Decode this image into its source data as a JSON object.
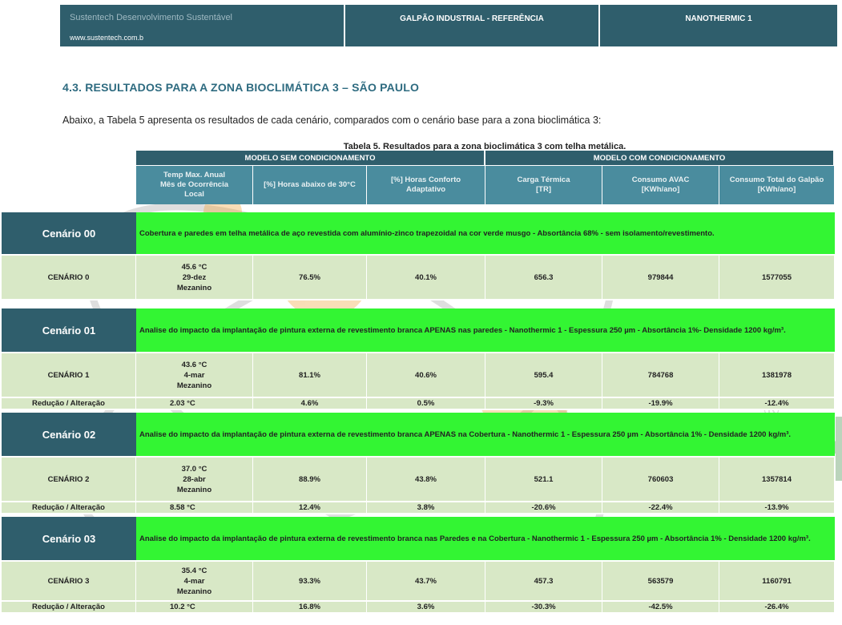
{
  "header": {
    "company": "Sustentech Desenvolvimento Sustentável",
    "site": "www.sustentech.com.b",
    "reference": "GALPÃO INDUSTRIAL - REFERÊNCIA",
    "product": "NANOTHERMIC 1"
  },
  "section_title": "4.3. RESULTADOS PARA A ZONA BIOCLIMÁTICA 3 – SÃO PAULO",
  "intro": "Abaixo, a Tabela 5 apresenta os resultados de cada cenário, comparados com o cenário base para a zona bioclimática 3:",
  "caption": "Tabela 5. Resultados para a zona bioclimática 3 com telha metálica.",
  "table": {
    "group_left": "MODELO SEM CONDICIONAMENTO",
    "group_right": "MODELO COM CONDICIONAMENTO",
    "columns": [
      "Temp Max. Anual\nMês de Ocorrência\nLocal",
      "[%] Horas abaixo de 30°C",
      "[%] Horas Conforto\nAdaptativo",
      "Carga Térmica\n[TR]",
      "Consumo AVAC\n[KWh/ano]",
      "Consumo Total do Galpão\n[KWh/ano]"
    ],
    "reduction_label": "Redução / Alteração",
    "scenarios": [
      {
        "title": "Cenário 00",
        "description": "Cobertura e paredes em telha metálica de aço revestida com alumínio-zinco trapezoidal na cor verde musgo - Absortância 68% - sem isolamento/revestimento.",
        "row_label": "CENÁRIO 0",
        "temp": "45.6   °C",
        "month": "29-dez",
        "local": "Mezanino",
        "hours_below_30": "76.5%",
        "comfort": "40.1%",
        "thermal_load": "656.3",
        "hvac": "979844",
        "total": "1577055",
        "reduction": null
      },
      {
        "title": "Cenário 01",
        "description": "Analise do impacto da implantação de pintura externa de revestimento branca APENAS nas paredes - Nanothermic 1 - Espessura 250 µm - Absortância 1%- Densidade 1200 kg/m³.",
        "row_label": "CENÁRIO 1",
        "temp": "43.6   °C",
        "month": "4-mar",
        "local": "Mezanino",
        "hours_below_30": "81.1%",
        "comfort": "40.6%",
        "thermal_load": "595.4",
        "hvac": "784768",
        "total": "1381978",
        "reduction": {
          "temp": "2.03   °C",
          "hours_below_30": "4.6%",
          "comfort": "0.5%",
          "thermal_load": "-9.3%",
          "hvac": "-19.9%",
          "total": "-12.4%"
        }
      },
      {
        "title": "Cenário 02",
        "description": "Analise do impacto da implantação de pintura externa de revestimento branca APENAS na Cobertura - Nanothermic 1 - Espessura 250 µm - Absortância 1% - Densidade 1200 kg/m³.",
        "row_label": "CENÁRIO 2",
        "temp": "37.0   °C",
        "month": "28-abr",
        "local": "Mezanino",
        "hours_below_30": "88.9%",
        "comfort": "43.8%",
        "thermal_load": "521.1",
        "hvac": "760603",
        "total": "1357814",
        "reduction": {
          "temp": "8.58   °C",
          "hours_below_30": "12.4%",
          "comfort": "3.8%",
          "thermal_load": "-20.6%",
          "hvac": "-22.4%",
          "total": "-13.9%"
        }
      },
      {
        "title": "Cenário 03",
        "description": "Analise do impacto da implantação de pintura externa de revestimento branca nas Paredes e na Cobertura - Nanothermic 1 - Espessura 250 µm - Absortância 1% - Densidade 1200 kg/m³.",
        "row_label": "CENÁRIO 3",
        "temp": "35.4   °C",
        "month": "4-mar",
        "local": "Mezanino",
        "hours_below_30": "93.3%",
        "comfort": "43.7%",
        "thermal_load": "457.3",
        "hvac": "563579",
        "total": "1160791",
        "reduction": {
          "temp": "10.2   °C",
          "hours_below_30": "16.8%",
          "comfort": "3.6%",
          "thermal_load": "-30.3%",
          "hvac": "-42.5%",
          "total": "-26.4%"
        }
      }
    ]
  },
  "watermark": {
    "word": "NANOTECH",
    "sub": "DO BRASIL",
    "mark": "®"
  }
}
